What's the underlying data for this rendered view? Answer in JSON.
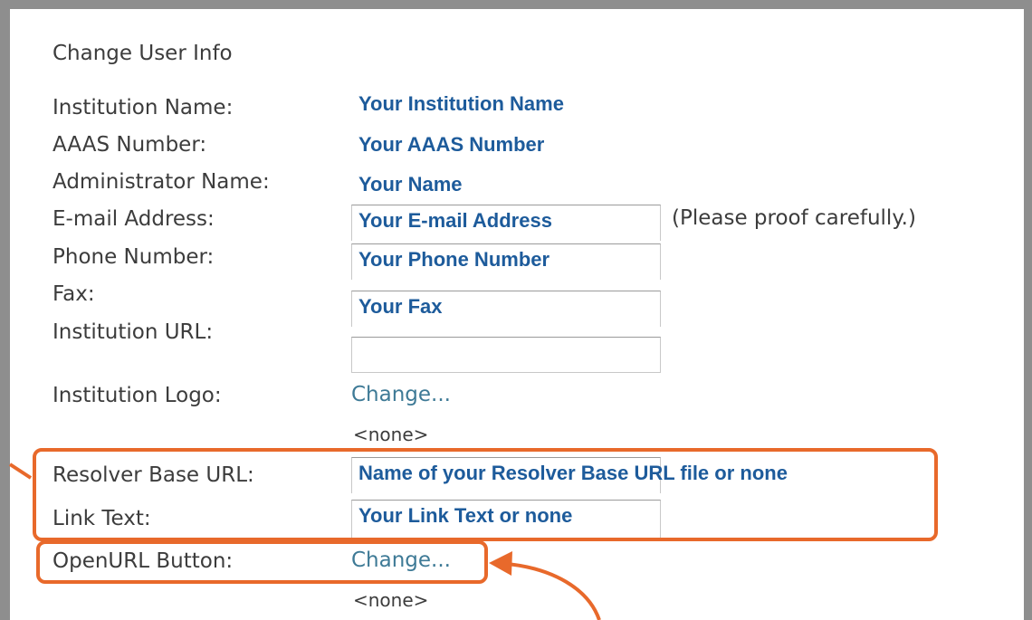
{
  "form": {
    "title": "Change User Info",
    "labels": {
      "institution_name": "Institution Name:",
      "aaas_number": "AAAS Number:",
      "administrator_name": "Administrator Name:",
      "email": "E-mail Address:",
      "phone": "Phone Number:",
      "fax": "Fax:",
      "institution_url": "Institution URL:",
      "institution_logo": "Institution Logo:",
      "resolver_base_url": "Resolver Base URL:",
      "link_text": "Link Text:",
      "openurl_button": "OpenURL Button:"
    },
    "values": {
      "institution_name": "Your Institution Name",
      "aaas_number": "Your AAAS Number",
      "administrator_name": "Your Name",
      "email": "Your E-mail Address",
      "phone": "Your Phone Number",
      "fax": "Your Fax",
      "institution_url": "",
      "resolver_base_url": "Name of your Resolver Base URL file or none",
      "link_text": "Your Link Text or none"
    },
    "email_note": "(Please proof carefully.)",
    "change_link": "Change...",
    "none_text": "<none>"
  },
  "colors": {
    "frame": "#8e8e8e",
    "label_text": "#3c3c3c",
    "value_text": "#1d5b9b",
    "link": "#3e7a96",
    "highlight": "#e8692b"
  },
  "icons": [
    "callout-arrow-icon"
  ]
}
